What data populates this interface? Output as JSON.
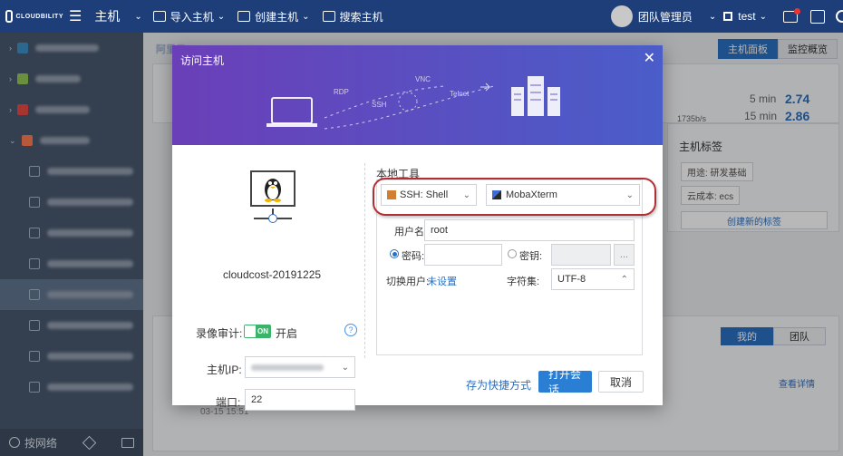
{
  "topbar": {
    "logo_text": "CLOUDBILITY",
    "logo_sub": "行云管家",
    "menu_title": "主机",
    "import_label": "导入主机",
    "create_label": "创建主机",
    "search_label": "搜索主机",
    "team_admin": "团队管理员",
    "user": "test"
  },
  "bg": {
    "breadcrumb": "阿里云/... ...-20191225",
    "tab_host_panel": "主机面板",
    "tab_monitor": "监控概览",
    "load_5": "5 min",
    "load_5_val": "2.74",
    "load_15": "15 min",
    "load_15_val": "2.86",
    "speed": "1735b/s",
    "host_tags_title": "主机标签",
    "tag1": "用途: 研发基础",
    "tag2": "云成本: ecs",
    "create_tag": "创建新的标签",
    "tab_mine": "我的",
    "tab_team": "团队",
    "view_detail": "查看详情",
    "date": "03-15 15:51"
  },
  "sidebar": {
    "items": [
      "Aye...",
      "nuxrdar",
      "OpenStack",
      "阿里云T",
      "golden-主机",
      "测试...",
      "万达...",
      "Aliv..",
      "在该...",
      "生产...",
      "测试...",
      "测试...",
      "testsup..."
    ],
    "footer_label": "按网络"
  },
  "modal": {
    "title": "访问主机",
    "close": "✕",
    "banner_labels": [
      "RDP",
      "SSH",
      "VNC",
      "Telnet"
    ],
    "host_name": "cloudcost-20191225",
    "host_ip_label": "主机IP:",
    "port_label": "端口:",
    "port_value": "22",
    "record_label": "录像审计:",
    "toggle_text": "ON",
    "record_state": "开启",
    "help": "?",
    "local_tool": "本地工具",
    "ssh_select": "SSH: Shell",
    "client_select": "MobaXterm",
    "username_label": "用户名:",
    "username_value": "root",
    "password_label": "密码:",
    "key_label": "密钥:",
    "switch_user_label": "切换用户:",
    "switch_user_value": "未设置",
    "charset_label": "字符集:",
    "charset_value": "UTF-8",
    "key_btn": "...",
    "save_shortcut": "存为快捷方式",
    "open_session": "打开会话",
    "cancel": "取消"
  }
}
